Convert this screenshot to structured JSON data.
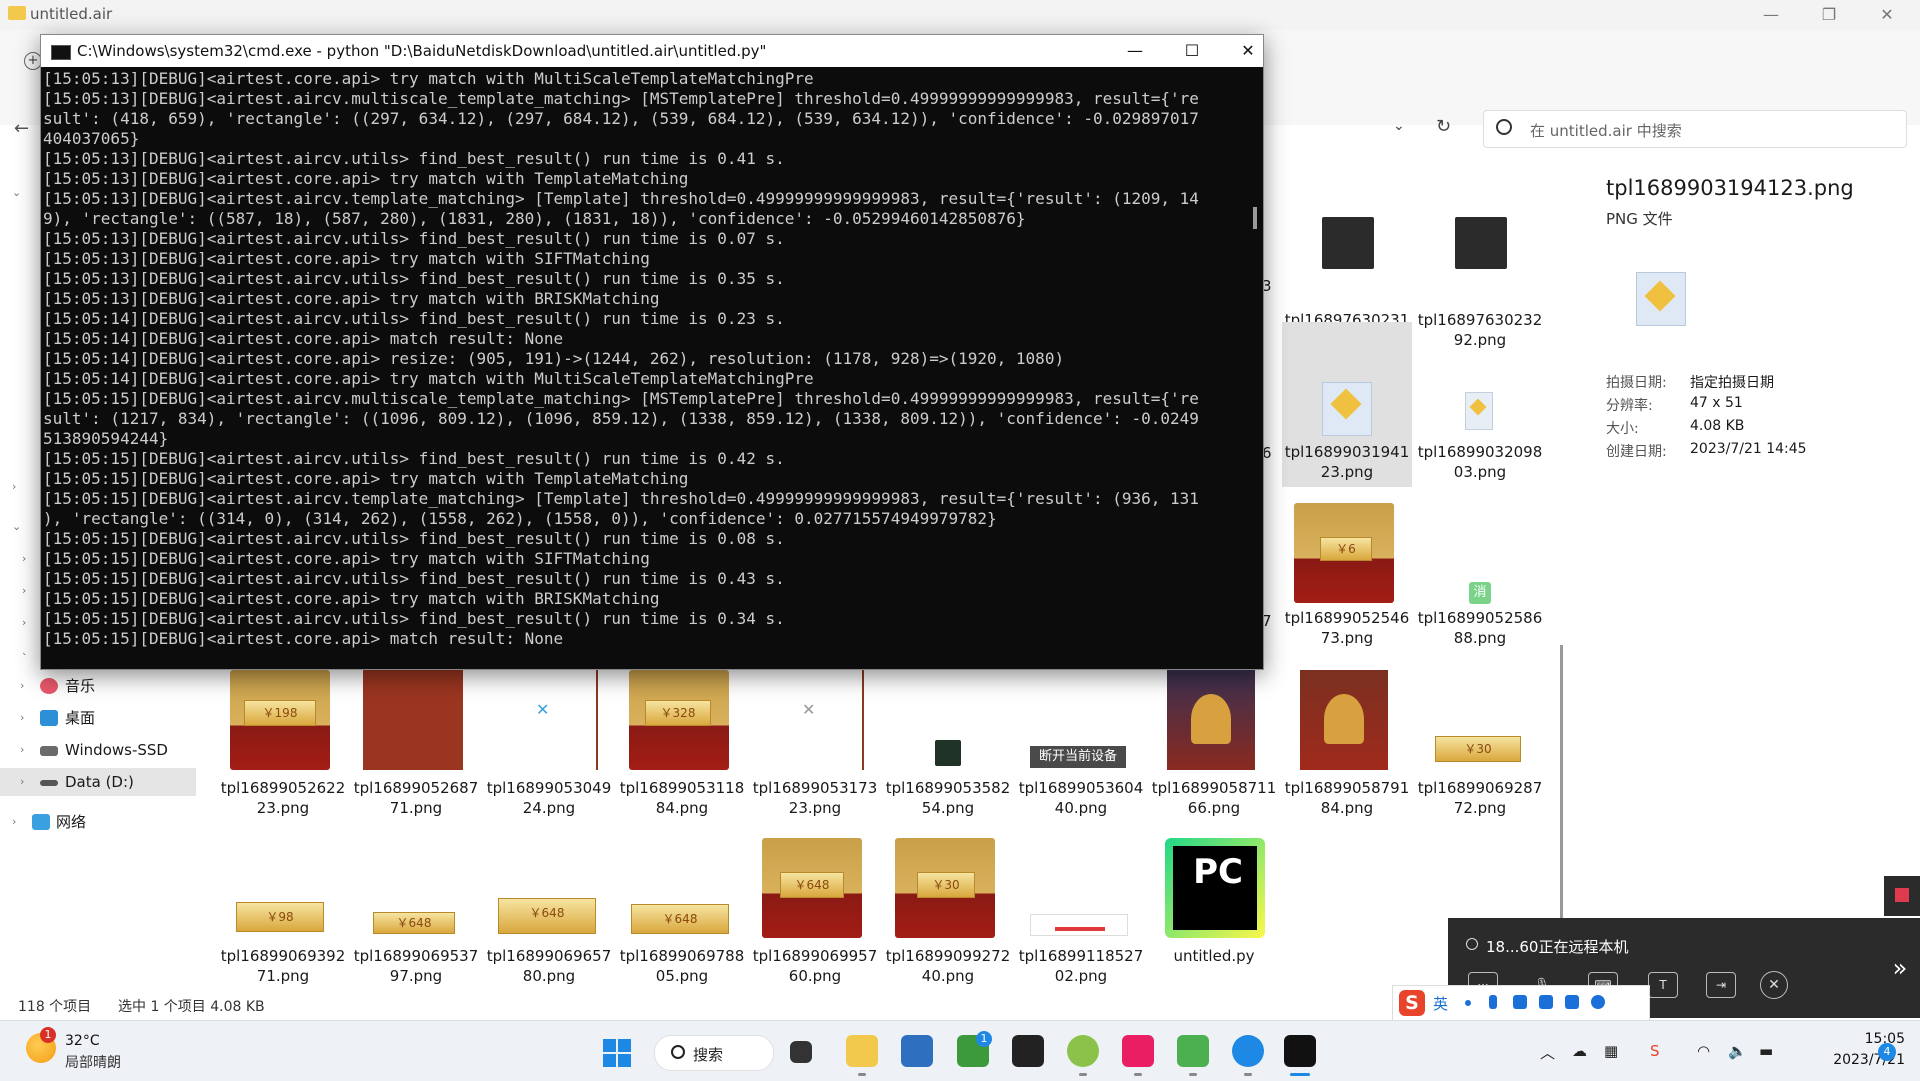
{
  "explorer": {
    "title": "untitled.air",
    "search_placeholder": "在 untitled.air 中搜索",
    "nav": [
      {
        "label": "音乐"
      },
      {
        "label": "桌面"
      },
      {
        "label": "Windows-SSD (C:)"
      },
      {
        "label": "Data (D:)"
      },
      {
        "label": "网络"
      }
    ],
    "files": [
      {
        "name": "tpl1689763023198.png"
      },
      {
        "name": "tpl1689763023292.png"
      },
      {
        "name": "tpl1689903194123.png"
      },
      {
        "name": "tpl1689903209803.png"
      },
      {
        "name": "tpl1689905254673.png"
      },
      {
        "name": "tpl1689905258688.png"
      },
      {
        "name": "tpl1689905262223.png"
      },
      {
        "name": "tpl1689905268771.png"
      },
      {
        "name": "tpl1689905304924.png"
      },
      {
        "name": "tpl1689905311884.png"
      },
      {
        "name": "tpl1689905317323.png"
      },
      {
        "name": "tpl1689905358254.png"
      },
      {
        "name": "tpl1689905360440.png"
      },
      {
        "name": "tpl1689905871166.png"
      },
      {
        "name": "tpl1689905879184.png"
      },
      {
        "name": "tpl1689906928772.png"
      },
      {
        "name": "tpl1689906939271.png"
      },
      {
        "name": "tpl1689906953797.png"
      },
      {
        "name": "tpl1689906965780.png"
      },
      {
        "name": "tpl1689906978805.png"
      },
      {
        "name": "tpl1689906995760.png"
      },
      {
        "name": "tpl1689909927240.png"
      },
      {
        "name": "tpl1689911852702.png"
      },
      {
        "name": "untitled.py"
      }
    ],
    "partial_digits": [
      "3",
      "6",
      "7"
    ],
    "thumb_labels": {
      "y6": "￥6",
      "y198": "￥198",
      "y328": "￥328",
      "y30": "￥30",
      "y98": "￥98",
      "y648": "￥648",
      "disconnect": "断开当前设备",
      "xiao": "消",
      "pc": "PC"
    },
    "details": {
      "title": "tpl1689903194123.png",
      "type": "PNG 文件",
      "rows": [
        {
          "label": "拍摄日期:",
          "value": "指定拍摄日期"
        },
        {
          "label": "分辨率:",
          "value": "47 x 51"
        },
        {
          "label": "大小:",
          "value": "4.08 KB"
        },
        {
          "label": "创建日期:",
          "value": "2023/7/21 14:45"
        }
      ]
    },
    "status": {
      "count": "118 个项目",
      "selected": "选中 1 个项目  4.08 KB"
    }
  },
  "cmd": {
    "title": "C:\\Windows\\system32\\cmd.exe - python  \"D:\\BaiduNetdiskDownload\\untitled.air\\untitled.py\"",
    "lines": [
      "[15:05:13][DEBUG]<airtest.core.api> try match with MultiScaleTemplateMatchingPre",
      "[15:05:13][DEBUG]<airtest.aircv.multiscale_template_matching> [MSTemplatePre] threshold=0.49999999999999983, result={'re",
      "sult': (418, 659), 'rectangle': ((297, 634.12), (297, 684.12), (539, 684.12), (539, 634.12)), 'confidence': -0.029897017",
      "404037065}",
      "[15:05:13][DEBUG]<airtest.aircv.utils> find_best_result() run time is 0.41 s.",
      "[15:05:13][DEBUG]<airtest.core.api> try match with TemplateMatching",
      "[15:05:13][DEBUG]<airtest.aircv.template_matching> [Template] threshold=0.49999999999999983, result={'result': (1209, 14",
      "9), 'rectangle': ((587, 18), (587, 280), (1831, 280), (1831, 18)), 'confidence': -0.05299460142850876}",
      "[15:05:13][DEBUG]<airtest.aircv.utils> find_best_result() run time is 0.07 s.",
      "[15:05:13][DEBUG]<airtest.core.api> try match with SIFTMatching",
      "[15:05:13][DEBUG]<airtest.aircv.utils> find_best_result() run time is 0.35 s.",
      "[15:05:13][DEBUG]<airtest.core.api> try match with BRISKMatching",
      "[15:05:14][DEBUG]<airtest.aircv.utils> find_best_result() run time is 0.23 s.",
      "[15:05:14][DEBUG]<airtest.core.api> match result: None",
      "[15:05:14][DEBUG]<airtest.core.api> resize: (905, 191)->(1244, 262), resolution: (1178, 928)=>(1920, 1080)",
      "[15:05:14][DEBUG]<airtest.core.api> try match with MultiScaleTemplateMatchingPre",
      "[15:05:15][DEBUG]<airtest.aircv.multiscale_template_matching> [MSTemplatePre] threshold=0.49999999999999983, result={'re",
      "sult': (1217, 834), 'rectangle': ((1096, 809.12), (1096, 859.12), (1338, 859.12), (1338, 809.12)), 'confidence': -0.0249",
      "513890594244}",
      "[15:05:15][DEBUG]<airtest.aircv.utils> find_best_result() run time is 0.42 s.",
      "[15:05:15][DEBUG]<airtest.core.api> try match with TemplateMatching",
      "[15:05:15][DEBUG]<airtest.aircv.template_matching> [Template] threshold=0.49999999999999983, result={'result': (936, 131",
      "), 'rectangle': ((314, 0), (314, 262), (1558, 262), (1558, 0)), 'confidence': 0.027715574949979782}",
      "[15:05:15][DEBUG]<airtest.aircv.utils> find_best_result() run time is 0.08 s.",
      "[15:05:15][DEBUG]<airtest.core.api> try match with SIFTMatching",
      "[15:05:15][DEBUG]<airtest.aircv.utils> find_best_result() run time is 0.43 s.",
      "[15:05:15][DEBUG]<airtest.core.api> try match with BRISKMatching",
      "[15:05:15][DEBUG]<airtest.aircv.utils> find_best_result() run time is 0.34 s.",
      "[15:05:15][DEBUG]<airtest.core.api> match result: None"
    ]
  },
  "remote": {
    "text": "18...60正在远程本机"
  },
  "ime": {
    "lang": "英"
  },
  "taskbar": {
    "weather_temp": "32°C",
    "weather_desc": "局部晴朗",
    "weather_badge": "1",
    "search_label": "搜索",
    "store_badge": "1",
    "time": "15:05",
    "date": "2023/7/21",
    "notif_count": "4"
  },
  "colors": {
    "accent": "#1e88e5",
    "terminal_bg": "#0c0c0c",
    "terminal_fg": "#cccccc"
  }
}
